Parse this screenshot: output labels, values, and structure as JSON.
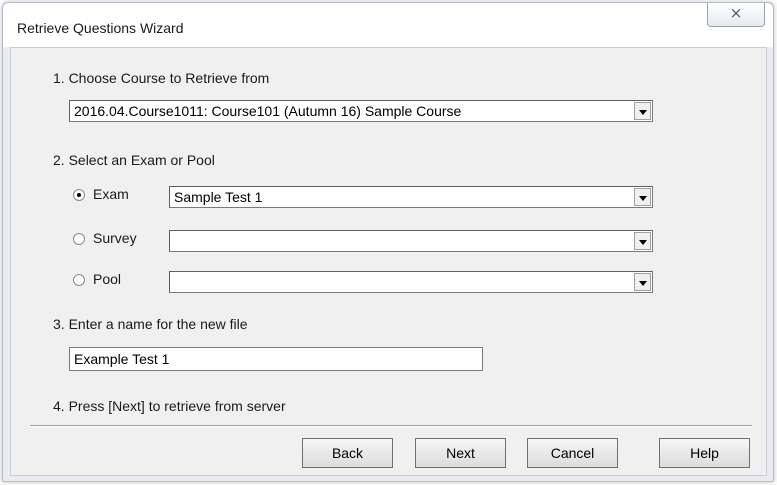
{
  "window": {
    "title": "Retrieve Questions Wizard",
    "close_glyph": "⨯"
  },
  "step1": {
    "label": "1. Choose Course to Retrieve from",
    "course_value": "2016.04.Course1011: Course101 (Autumn 16)  Sample Course"
  },
  "step2": {
    "label": "2. Select an Exam or Pool",
    "options": [
      {
        "label": "Exam",
        "selected": true,
        "value": "Sample Test 1"
      },
      {
        "label": "Survey",
        "selected": false,
        "value": ""
      },
      {
        "label": "Pool",
        "selected": false,
        "value": ""
      }
    ]
  },
  "step3": {
    "label": "3. Enter a name for the new file",
    "file_name": "Example Test 1"
  },
  "step4": {
    "label": "4. Press [Next] to retrieve from server"
  },
  "buttons": {
    "back": "Back",
    "next": "Next",
    "cancel": "Cancel",
    "help": "Help"
  }
}
